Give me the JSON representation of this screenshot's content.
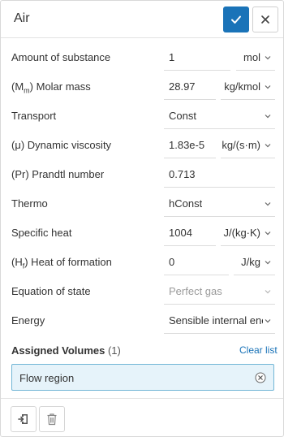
{
  "header": {
    "title": "Air",
    "confirm_icon": "check-icon",
    "close_icon": "close-icon",
    "accent_color": "#1a73b8"
  },
  "properties": [
    {
      "label": "Amount of substance",
      "value": "1",
      "unit": "mol"
    },
    {
      "label_main": "(M",
      "label_sub": "m",
      "label_tail": ") Molar mass",
      "value": "28.97",
      "unit": "kg/kmol"
    },
    {
      "label": "Transport",
      "value": "Const"
    },
    {
      "label": "(μ) Dynamic viscosity",
      "value": "1.83e-5",
      "unit": "kg/(s·m)"
    },
    {
      "label": "(Pr) Prandtl number",
      "value": "0.713"
    },
    {
      "label": "Thermo",
      "value": "hConst"
    },
    {
      "label": "Specific heat",
      "value": "1004",
      "unit": "J/(kg·K)"
    },
    {
      "label_main": "(H",
      "label_sub": "f",
      "label_tail": ") Heat of formation",
      "value": "0",
      "unit": "J/kg"
    },
    {
      "label": "Equation of state",
      "value": "Perfect gas",
      "disabled": true
    },
    {
      "label": "Energy",
      "value": "Sensible internal energy"
    }
  ],
  "assigned": {
    "title": "Assigned Volumes",
    "count": "(1)",
    "clear_label": "Clear list",
    "volumes": [
      {
        "label": "Flow region"
      }
    ],
    "highlight_color": "#e6f3fa"
  },
  "footer": {
    "buttons": [
      "import-icon",
      "trash-icon"
    ]
  }
}
